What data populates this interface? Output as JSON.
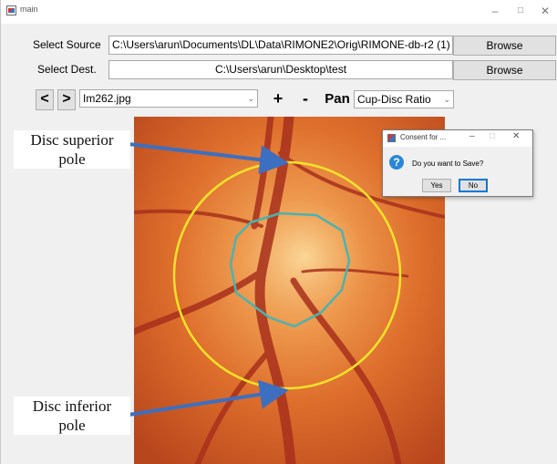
{
  "window": {
    "title": "main"
  },
  "controls": {
    "select_source_label": "Select Source",
    "source_path": "C:\\Users\\arun\\Documents\\DL\\Data\\RIMONE2\\Orig\\RIMONE-db-r2 (1)",
    "browse_label": "Browse",
    "select_dest_label": "Select Dest.",
    "dest_path": "C:\\Users\\arun\\Desktop\\test",
    "prev_label": "<",
    "next_label": ">",
    "image_file": "Im262.jpg",
    "zoom_in_label": "+",
    "zoom_out_label": "-",
    "pan_label": "Pan",
    "measure_mode": "Cup-Disc Ratio"
  },
  "annotations": {
    "superior_line1": "Disc superior",
    "superior_line2": "pole",
    "inferior_line1": "Disc inferior",
    "inferior_line2": "pole"
  },
  "dialog": {
    "title": "Consent for ...",
    "message": "Do you want to Save?",
    "yes_label": "Yes",
    "no_label": "No"
  },
  "colors": {
    "disc_outline": "#f5e32a",
    "cup_outline": "#4bb3b0",
    "arrow": "#3d6fc0",
    "fundus": "#d9662a"
  }
}
